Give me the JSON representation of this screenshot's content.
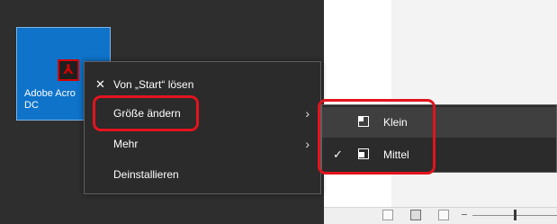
{
  "tile": {
    "label": "Adobe Acro\nDC",
    "icon": "acrobat-icon"
  },
  "context_menu": {
    "items": [
      {
        "label": "Von „Start“ lösen",
        "icon": "unpin-icon",
        "has_submenu": false
      },
      {
        "label": "Größe ändern",
        "has_submenu": true
      },
      {
        "label": "Mehr",
        "has_submenu": true
      },
      {
        "label": "Deinstallieren",
        "has_submenu": false
      }
    ],
    "submenu_arrow": "›"
  },
  "submenu": {
    "items": [
      {
        "label": "Klein",
        "checked": false,
        "icon": "small-size-icon"
      },
      {
        "label": "Mittel",
        "checked": true,
        "icon": "medium-size-icon"
      }
    ],
    "check_glyph": "✓"
  },
  "colors": {
    "tile_blue": "#0e73c9",
    "annotation_red": "#e2141d",
    "menu_bg": "#2b2b2b"
  }
}
